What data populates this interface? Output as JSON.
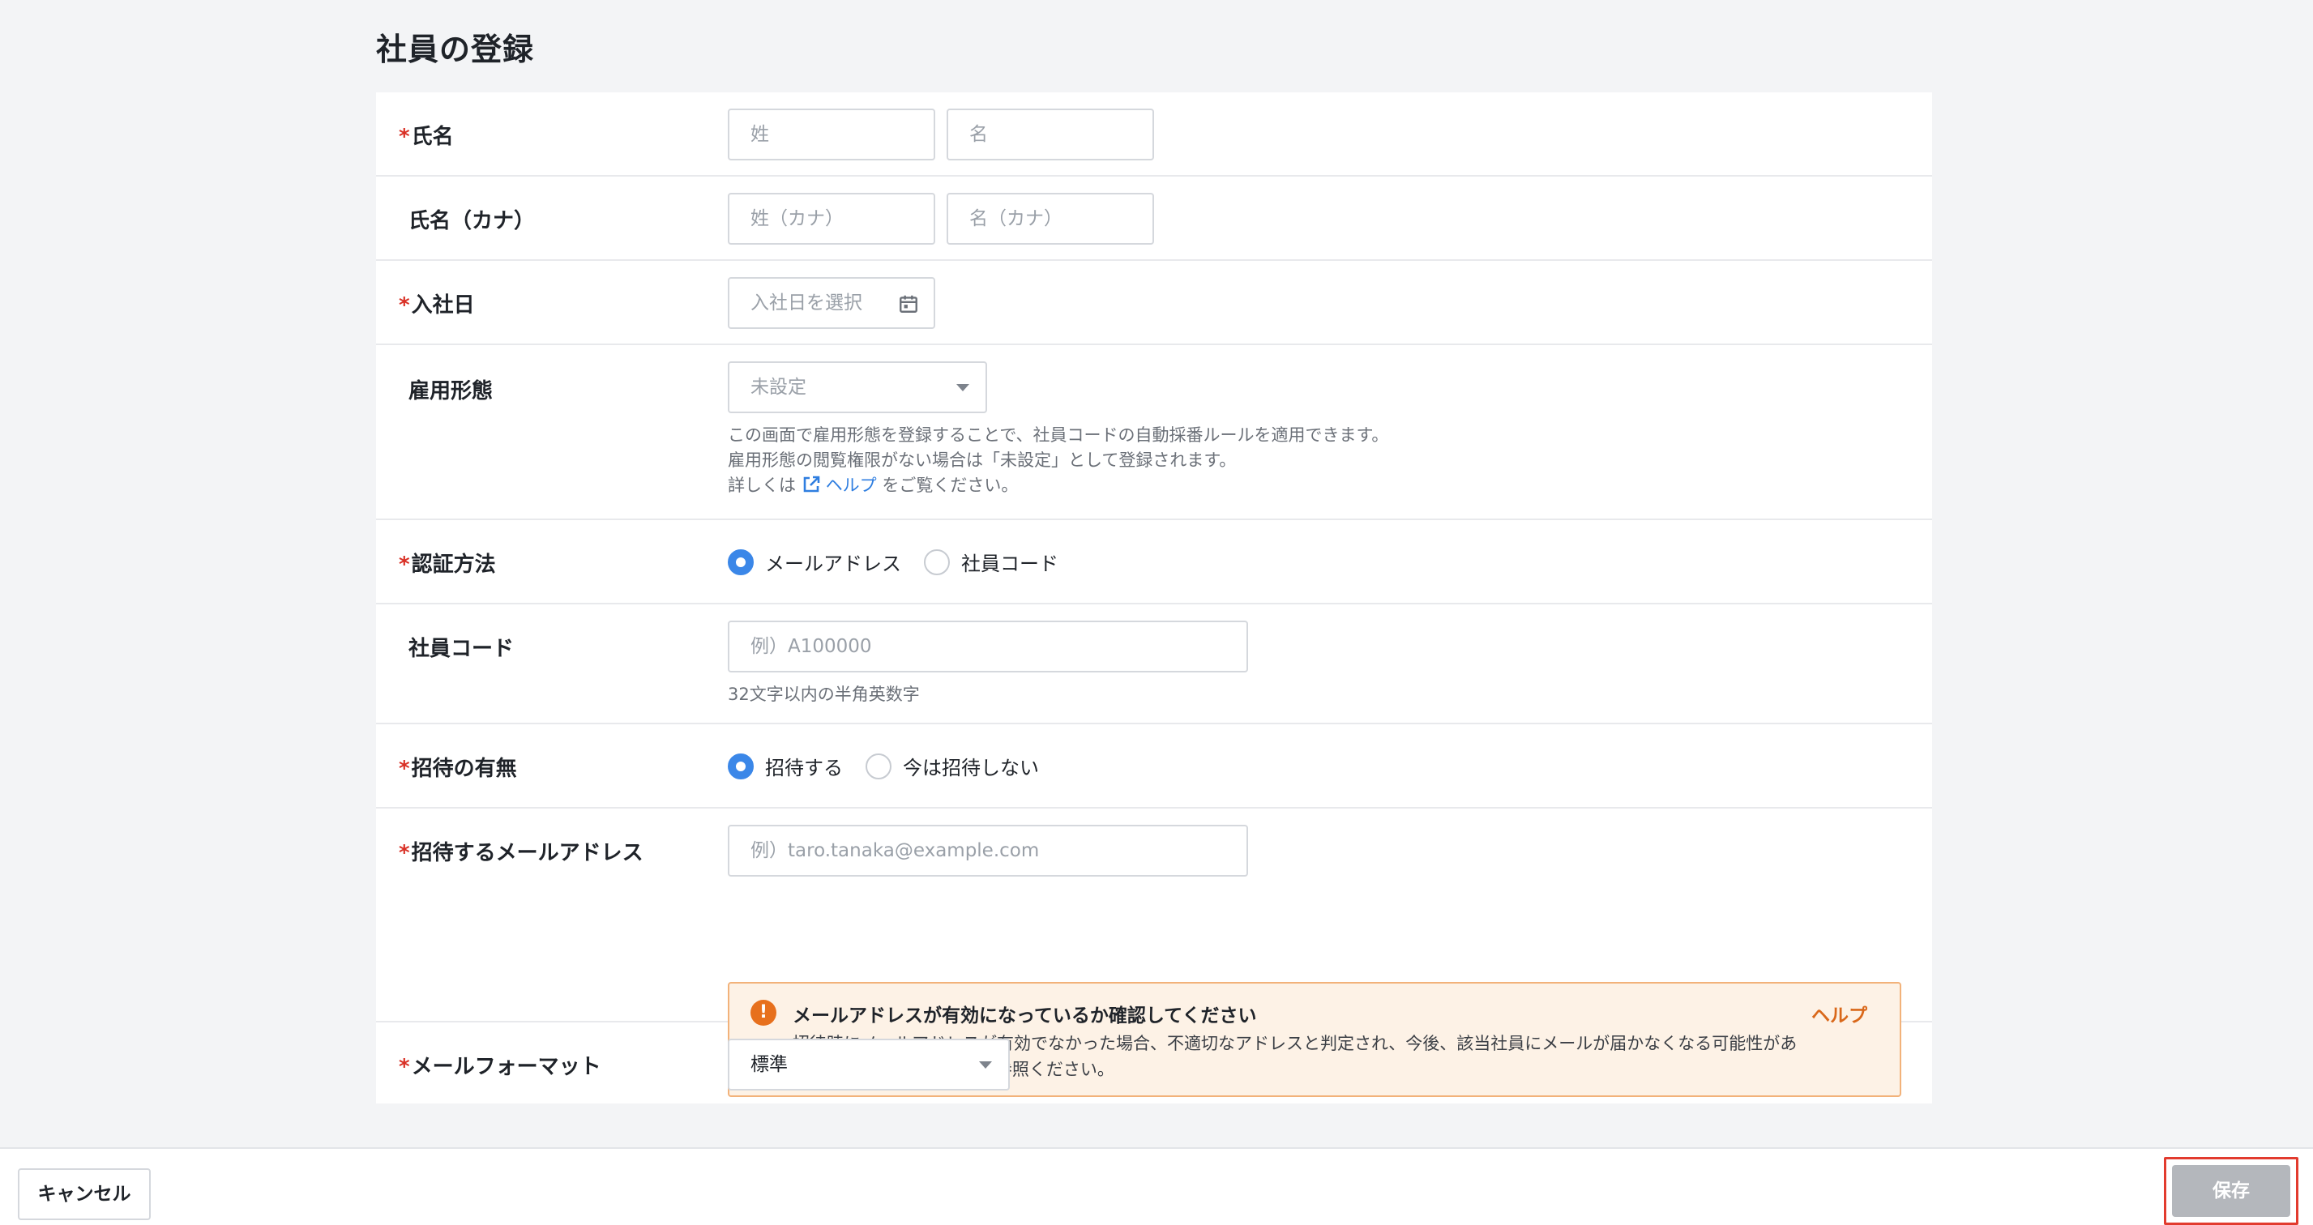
{
  "page": {
    "title": "社員の登録"
  },
  "form": {
    "name": {
      "label": "氏名",
      "required": true,
      "last_placeholder": "姓",
      "first_placeholder": "名"
    },
    "kana": {
      "label": "氏名（カナ）",
      "required": false,
      "last_placeholder": "姓（カナ）",
      "first_placeholder": "名（カナ）"
    },
    "hire_date": {
      "label": "入社日",
      "required": true,
      "placeholder": "入社日を選択",
      "icon": "calendar-icon"
    },
    "employment_type": {
      "label": "雇用形態",
      "required": false,
      "selected": "未設定",
      "hint_line1": "この画面で雇用形態を登録することで、社員コードの自動採番ルールを適用できます。",
      "hint_line2": "雇用形態の閲覧権限がない場合は「未設定」として登録されます。",
      "hint_prefix": "詳しくは",
      "hint_link": "ヘルプ",
      "hint_suffix": "をご覧ください。"
    },
    "auth_method": {
      "label": "認証方法",
      "required": true,
      "options": [
        "メールアドレス",
        "社員コード"
      ],
      "selected": "メールアドレス"
    },
    "employee_code": {
      "label": "社員コード",
      "required": false,
      "placeholder": "例）A100000",
      "hint": "32文字以内の半角英数字"
    },
    "invite": {
      "label": "招待の有無",
      "required": true,
      "options": [
        "招待する",
        "今は招待しない"
      ],
      "selected": "招待する"
    },
    "invite_email": {
      "label": "招待するメールアドレス",
      "required": true,
      "placeholder": "例）taro.tanaka@example.com",
      "alert": {
        "title": "メールアドレスが有効になっているか確認してください",
        "body": "招待時にメールアドレスが有効でなかった場合、不適切なアドレスと判定され、今後、該当社員にメールが届かなくなる可能性があります。詳細はヘルプをご参照ください。",
        "help": "ヘルプ"
      }
    },
    "mail_format": {
      "label": "メールフォーマット",
      "required": true,
      "selected": "標準"
    }
  },
  "footer": {
    "cancel_label": "キャンセル",
    "save_label": "保存"
  },
  "colors": {
    "accent": "#3b87e8",
    "required": "#d93025",
    "warning": "#e7701d",
    "save_highlight": "#e23b2e"
  }
}
